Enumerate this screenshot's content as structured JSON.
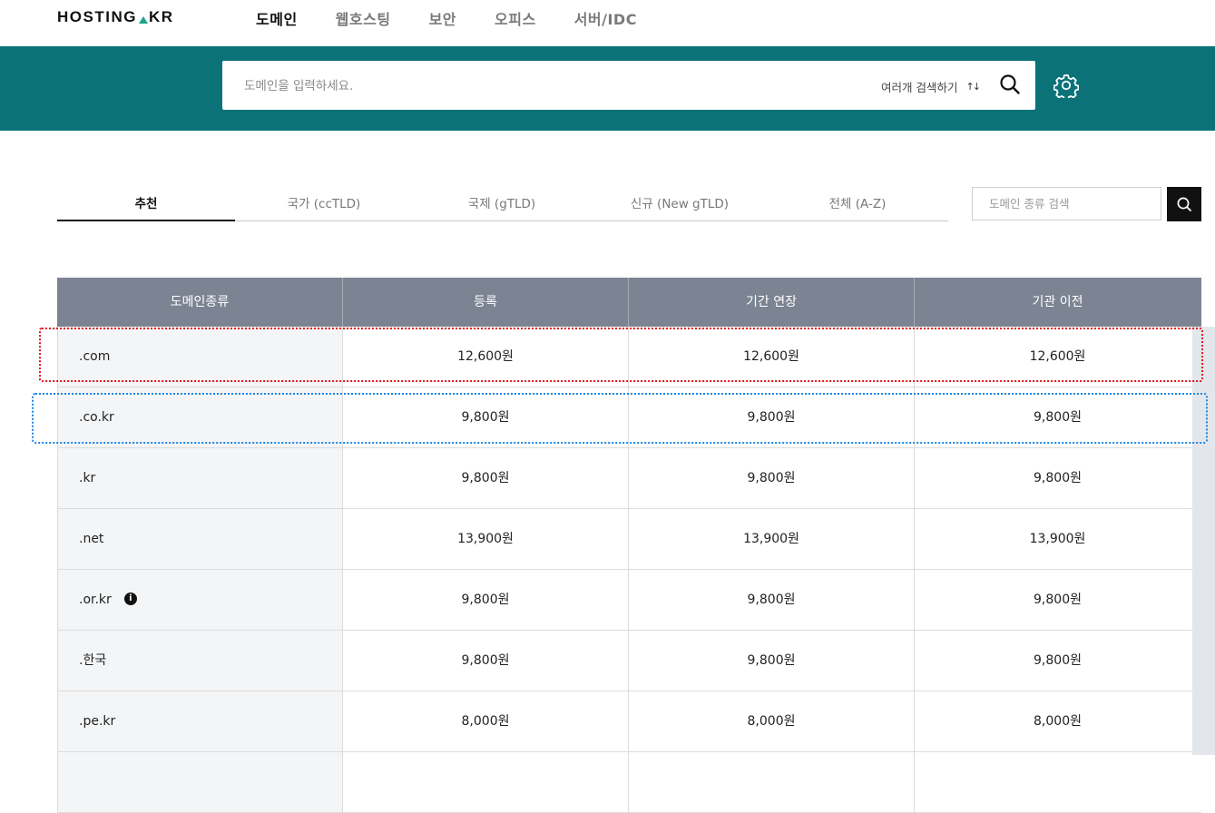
{
  "logo": {
    "part1": "HOSTING",
    "part2": "KR"
  },
  "nav": [
    "도메인",
    "웹호스팅",
    "보안",
    "오피스",
    "서버/IDC"
  ],
  "search": {
    "placeholder": "도메인을 입력하세요.",
    "multi_label": "여러개 검색하기",
    "multi_icon": "↑↓"
  },
  "tabs": [
    "추천",
    "국가 (ccTLD)",
    "국제 (gTLD)",
    "신규 (New gTLD)",
    "전체 (A-Z)"
  ],
  "tld_search": {
    "placeholder": "도메인 종류 검색"
  },
  "table": {
    "headers": [
      "도메인종류",
      "등록",
      "기간 연장",
      "기관 이전"
    ],
    "rows": [
      {
        "name": ".com",
        "register": "12,600원",
        "renew": "12,600원",
        "transfer": "12,600원"
      },
      {
        "name": ".co.kr",
        "register": "9,800원",
        "renew": "9,800원",
        "transfer": "9,800원"
      },
      {
        "name": ".kr",
        "register": "9,800원",
        "renew": "9,800원",
        "transfer": "9,800원"
      },
      {
        "name": ".net",
        "register": "13,900원",
        "renew": "13,900원",
        "transfer": "13,900원"
      },
      {
        "name": ".or.kr",
        "register": "9,800원",
        "renew": "9,800원",
        "transfer": "9,800원"
      },
      {
        "name": ".한국",
        "register": "9,800원",
        "renew": "9,800원",
        "transfer": "9,800원"
      },
      {
        "name": ".pe.kr",
        "register": "8,000원",
        "renew": "8,000원",
        "transfer": "8,000원"
      }
    ]
  },
  "colors": {
    "brand_teal": "#0b7278",
    "header_gray": "#7c8493",
    "logo_accent": "#17a589",
    "highlight_red": "#e0151b",
    "highlight_blue": "#1a86e6"
  }
}
